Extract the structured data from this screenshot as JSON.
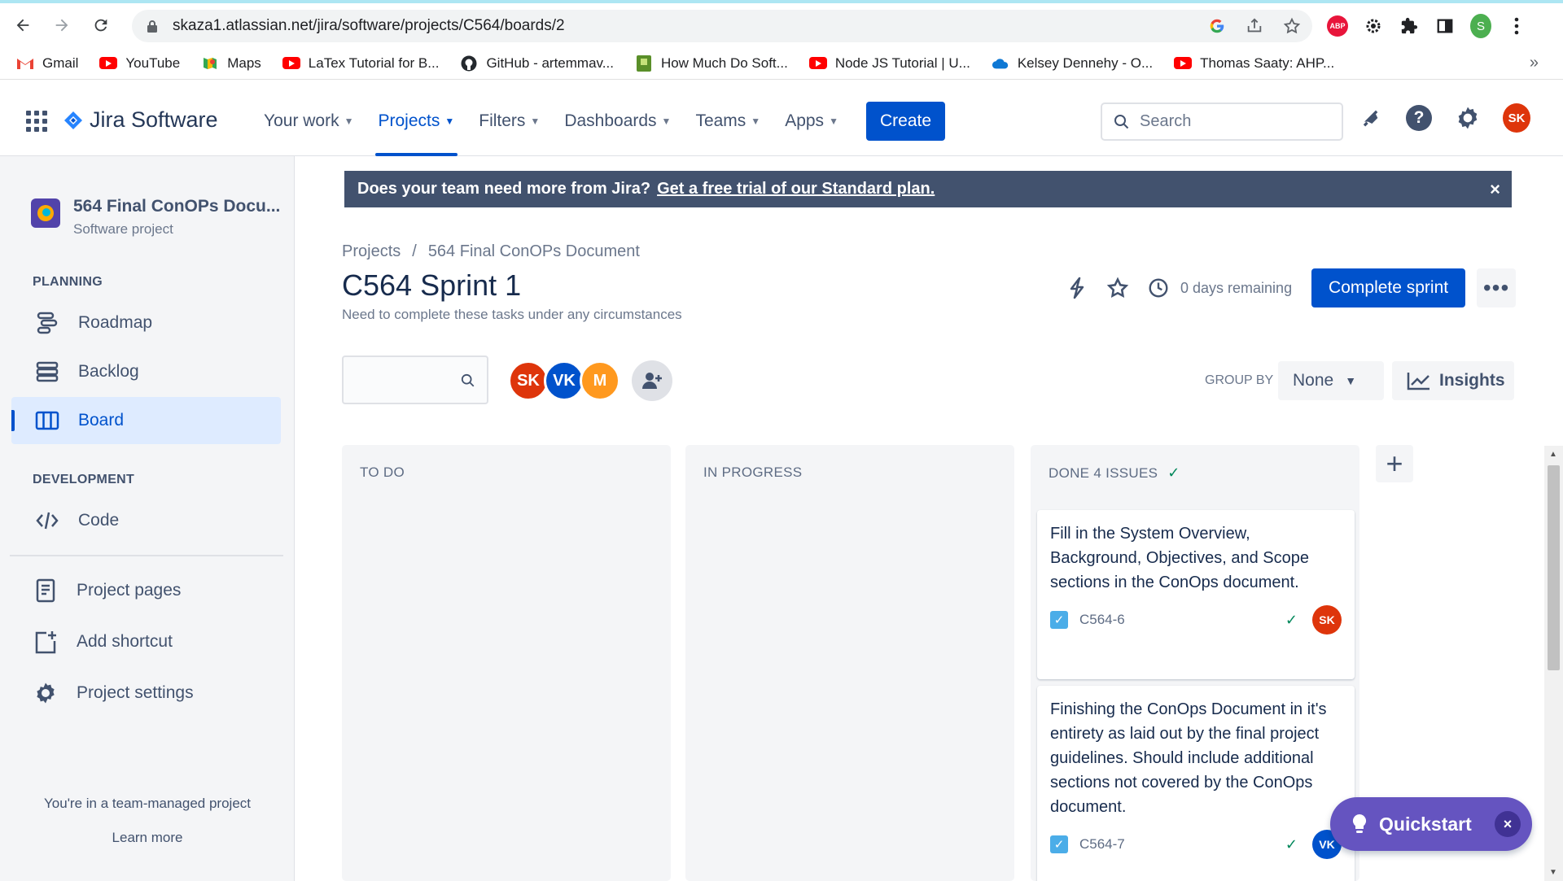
{
  "browser": {
    "url": "skaza1.atlassian.net/jira/software/projects/C564/boards/2",
    "profile_initial": "S",
    "abp_label": "ABP",
    "bookmarks": [
      {
        "label": "Gmail",
        "icon": "gmail-icon"
      },
      {
        "label": "YouTube",
        "icon": "youtube-icon"
      },
      {
        "label": "Maps",
        "icon": "maps-icon"
      },
      {
        "label": "LaTex Tutorial for B...",
        "icon": "youtube-icon"
      },
      {
        "label": "GitHub - artemmav...",
        "icon": "github-icon"
      },
      {
        "label": "How Much Do Soft...",
        "icon": "green-page-icon"
      },
      {
        "label": "Node JS Tutorial | U...",
        "icon": "youtube-icon"
      },
      {
        "label": "Kelsey Dennehy - O...",
        "icon": "onedrive-icon"
      },
      {
        "label": "Thomas Saaty: AHP...",
        "icon": "youtube-icon"
      }
    ],
    "bookmarks_more": "»"
  },
  "jira_nav": {
    "product": "Jira Software",
    "items": [
      {
        "label": "Your work",
        "active": false
      },
      {
        "label": "Projects",
        "active": true
      },
      {
        "label": "Filters",
        "active": false
      },
      {
        "label": "Dashboards",
        "active": false
      },
      {
        "label": "Teams",
        "active": false
      },
      {
        "label": "Apps",
        "active": false
      }
    ],
    "create_label": "Create",
    "search_placeholder": "Search",
    "user_initials": "SK",
    "help_label": "?"
  },
  "sidebar": {
    "project_name": "564 Final ConOPs Docu...",
    "project_type": "Software project",
    "planning_label": "PLANNING",
    "planning_items": [
      {
        "label": "Roadmap",
        "icon": "roadmap-icon"
      },
      {
        "label": "Backlog",
        "icon": "backlog-icon"
      },
      {
        "label": "Board",
        "icon": "board-icon",
        "active": true
      }
    ],
    "development_label": "DEVELOPMENT",
    "code_label": "Code",
    "extra_items": [
      {
        "label": "Project pages",
        "icon": "project-pages-icon"
      },
      {
        "label": "Add shortcut",
        "icon": "add-shortcut-icon"
      },
      {
        "label": "Project settings",
        "icon": "gear-icon"
      }
    ],
    "footer_text": "You're in a team-managed project",
    "learn_more": "Learn more"
  },
  "banner": {
    "text": "Does your team need more from Jira?",
    "link": "Get a free trial of our Standard plan.",
    "close": "×"
  },
  "header": {
    "breadcrumb_root": "Projects",
    "breadcrumb_sep": "/",
    "breadcrumb_project": "564 Final ConOPs Document",
    "title": "C564 Sprint 1",
    "subtitle": "Need to complete these tasks under any circumstances",
    "days_remaining": "0 days remaining",
    "complete_label": "Complete sprint",
    "more_label": "•••"
  },
  "filters": {
    "people": [
      {
        "initials": "SK",
        "color": "#de350b"
      },
      {
        "initials": "VK",
        "color": "#0052cc"
      },
      {
        "initials": "M",
        "color": "#ff991f"
      }
    ],
    "group_by_label": "GROUP BY",
    "group_by_value": "None",
    "insights_label": "Insights"
  },
  "board": {
    "columns": [
      {
        "title": "TO DO"
      },
      {
        "title": "IN PROGRESS"
      },
      {
        "title": "DONE 4 ISSUES"
      }
    ],
    "add_column": "+",
    "cards": [
      {
        "text": "Fill in the System Overview, Background, Objectives, and Scope sections in the ConOps document.",
        "key": "C564-6",
        "assignee": "SK",
        "assignee_color": "#de350b"
      },
      {
        "text": "Finishing the ConOps Document in it's entirety as laid out by the final project guidelines. Should include additional sections not covered by the ConOps document.",
        "key": "C564-7",
        "assignee": "VK",
        "assignee_color": "#0052cc"
      }
    ]
  },
  "quickstart": {
    "label": "Quickstart",
    "close": "×"
  },
  "colors": {
    "brand": "#0052cc",
    "banner": "#42526e",
    "quickstart": "#6554c0",
    "done_check": "#00875a"
  }
}
